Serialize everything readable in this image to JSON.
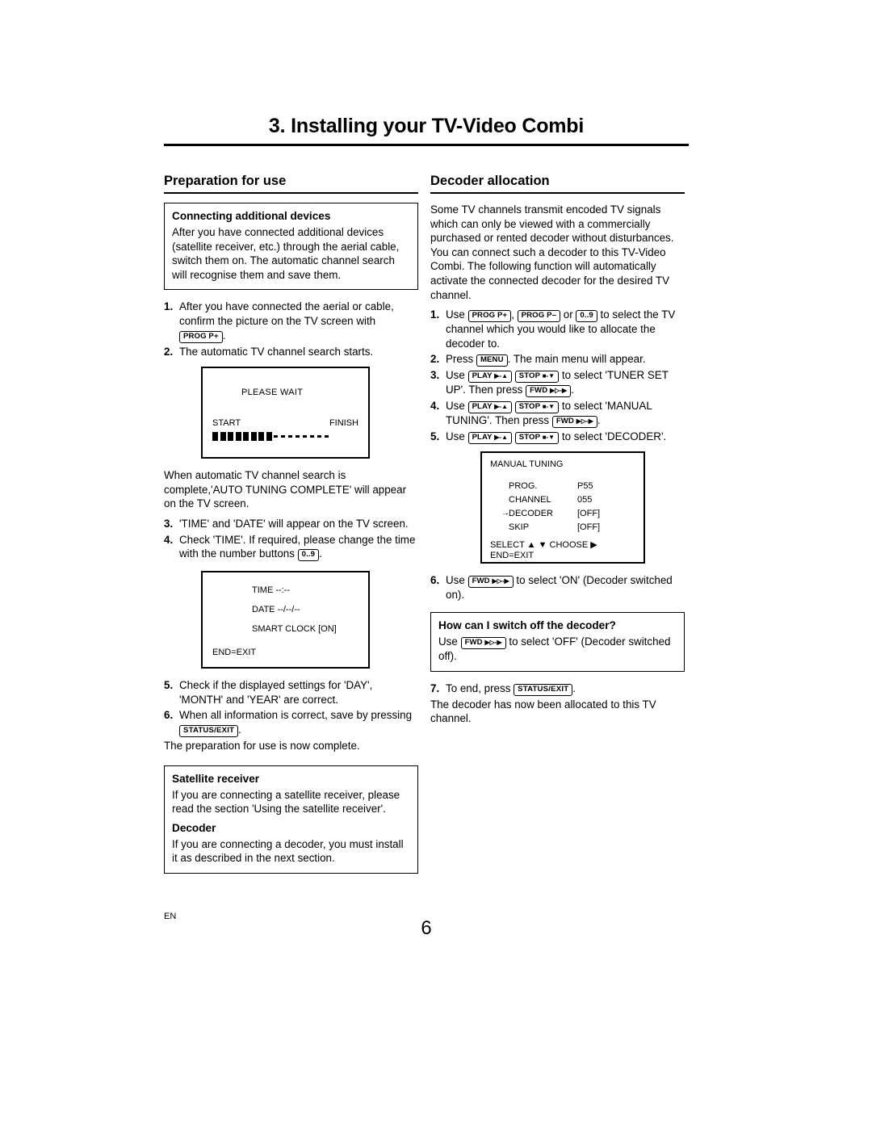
{
  "page": {
    "title": "3. Installing your TV-Video Combi",
    "footer_lang": "EN",
    "page_number": "6"
  },
  "left": {
    "heading": "Preparation for use",
    "note1": {
      "title": "Connecting additional devices",
      "text": "After you have connected additional devices (satellite receiver, etc.) through the aerial cable, switch them on. The automatic channel search will recognise them and save them."
    },
    "steps": [
      {
        "num": "1.",
        "text_a": "After you have connected the aerial or cable, confirm the picture on the TV screen with",
        "key": "PROG P+",
        "text_b": "."
      },
      {
        "num": "2.",
        "text_a": "The automatic TV channel search starts."
      }
    ],
    "screen_wait": {
      "please_wait": "PLEASE WAIT",
      "start": "START",
      "finish": "FINISH"
    },
    "para_complete": "When automatic TV channel search is complete,'AUTO TUNING COMPLETE' will appear on the TV screen.",
    "steps2": [
      {
        "num": "3.",
        "text_a": "'TIME' and 'DATE' will appear on the TV screen."
      },
      {
        "num": "4.",
        "text_a": "Check 'TIME'. If required, please change the time with the number buttons",
        "key": "0..9",
        "text_b": "."
      }
    ],
    "screen_time": {
      "time": "TIME --:--",
      "date": "DATE --/--/--",
      "smart_clock": "SMART CLOCK [ON]",
      "end_exit": "END=EXIT"
    },
    "steps3": [
      {
        "num": "5.",
        "text_a": "Check if the displayed settings for 'DAY', 'MONTH' and 'YEAR' are correct."
      },
      {
        "num": "6.",
        "text_a": "When all information is correct, save by pressing",
        "key": "STATUS/EXIT",
        "text_b": "."
      }
    ],
    "para_done": "The preparation for use is now complete.",
    "note2": {
      "title": "Satellite receiver",
      "text": "If you are connecting a satellite receiver, please read the section 'Using the satellite receiver'.",
      "title2": "Decoder",
      "text2": "If you are connecting a decoder, you must install it as described in the next section."
    }
  },
  "right": {
    "heading": "Decoder allocation",
    "intro": "Some TV channels transmit encoded TV signals which can only be viewed with a commercially purchased or rented decoder without disturbances. You can connect such a decoder to this TV-Video Combi. The following function will automatically activate the connected decoder for the desired TV channel.",
    "steps": [
      {
        "num": "1.",
        "lead": "Use",
        "key1": "PROG P+",
        "sep1": ",",
        "key2": "PROG P–",
        "sep2": "or",
        "key3": "0..9",
        "tail": "to select the TV channel which you would like to allocate the decoder to."
      },
      {
        "num": "2.",
        "lead": "Press",
        "key1": "MENU",
        "tail": ". The main menu will appear."
      },
      {
        "num": "3.",
        "lead": "Use",
        "key1": "PLAY",
        "key2": "STOP",
        "tail": "to select 'TUNER SET UP'. Then press",
        "key3": "FWD",
        "tail2": "."
      },
      {
        "num": "4.",
        "lead": "Use",
        "key1": "PLAY",
        "key2": "STOP",
        "tail": "to select 'MANUAL TUNING'. Then press",
        "key3": "FWD",
        "tail2": "."
      },
      {
        "num": "5.",
        "lead": "Use",
        "key1": "PLAY",
        "key2": "STOP",
        "tail": "to select 'DECODER'."
      }
    ],
    "screen_manual": {
      "header": "MANUAL TUNING",
      "rows": [
        {
          "label": "PROG.",
          "value": "P55"
        },
        {
          "label": "CHANNEL",
          "value": "055"
        },
        {
          "label": "DECODER",
          "value": "[OFF]"
        },
        {
          "label": "SKIP",
          "value": "[OFF]"
        }
      ],
      "footer1": "SELECT ▲ ▼  CHOOSE ▶",
      "footer2": "END=EXIT"
    },
    "step6": {
      "num": "6.",
      "lead": "Use",
      "key1": "FWD",
      "tail": "to select 'ON' (Decoder switched on)."
    },
    "note": {
      "title": "How can I switch off the decoder?",
      "lead": "Use",
      "key1": "FWD",
      "tail": "to select 'OFF' (Decoder switched off)."
    },
    "step7": {
      "num": "7.",
      "lead": "To end, press",
      "key1": "STATUS/EXIT",
      "tail": "."
    },
    "closing": "The decoder has now been allocated to this TV channel."
  }
}
